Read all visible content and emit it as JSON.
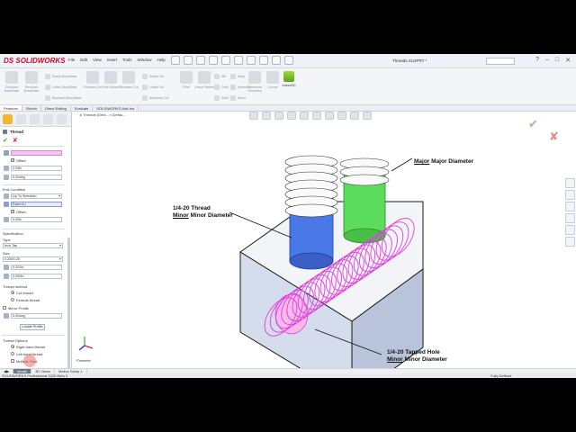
{
  "app": {
    "logo_ds": "DS",
    "logo_text": "SOLIDWORKS",
    "document_title": "Threads.SLDPRT *",
    "status_left": "SOLIDWORKS Professional 2020 Beta 3",
    "status_right": "Fully Defined"
  },
  "menus": [
    "File",
    "Edit",
    "View",
    "Insert",
    "Tools",
    "Window",
    "Help"
  ],
  "ribbon": {
    "big_buttons": [
      "Extruded Boss/Base",
      "Revolved Boss/Base",
      "Swept Boss/Base",
      "Extruded Cut",
      "Hole Wizard",
      "Revolved Cut",
      "Fillet",
      "Linear Pattern",
      "Rib",
      "Wrap",
      "Intersect",
      "Reference Geometry",
      "Curves"
    ],
    "small_buttons": [
      "Swept Boss/Base",
      "Lofted Boss/Base",
      "Boundary Boss/Base",
      "Swept Cut",
      "Lofted Cut",
      "Boundary Cut",
      "Draft",
      "Shell",
      "Mirror"
    ],
    "instant3d": "Instant3D"
  },
  "command_tabs": [
    "Features",
    "Sketch",
    "Direct Editing",
    "Evaluate",
    "SOLIDWORKS Add-Ins"
  ],
  "tree_path": "Threads (Defa...<<Defau...",
  "panel": {
    "title": "Thread",
    "edge_value": "",
    "offset_label": "Offset",
    "offset_value": "0.00in",
    "angle_value": "0.00deg",
    "end_condition_label": "End Condition",
    "end_condition_value": "Up To Selection",
    "face_value": "Face<1>",
    "offset2_label": "Offset",
    "offset2_value": "0.00in",
    "specification_label": "Specification",
    "type_label": "Type",
    "type_value": "Inch Tap",
    "size_label": "Size",
    "size_value": "0.2500-20",
    "diameter_value": "0.201in",
    "pitch_value": "0.050in",
    "thread_method_label": "Thread method",
    "cut_thread": "Cut thread",
    "extrude_thread": "Extrude thread",
    "mirror_profile": "Mirror Profile",
    "rotation_value": "0.00deg",
    "locate_profile": "Locate Profile",
    "thread_options_label": "Thread Options",
    "right_hand": "Right-hand thread",
    "left_hand": "Left-hand thread",
    "multiple_start": "Multiple Start"
  },
  "callouts": {
    "major": [
      "Major Diameter"
    ],
    "thread_minor": [
      "1/4-20 Thread",
      "Minor Diameter"
    ],
    "hole_minor": [
      "1/4-20 Tapped Hole",
      "Minor Diameter"
    ],
    "major_underline_word": "Major",
    "thread_minor_underline_word": "Minor",
    "hole_minor_underline_word": "Minor"
  },
  "view_label": "*Trimetric",
  "bottom_tabs": [
    "Model",
    "3D Views",
    "Motion Study 1"
  ],
  "colors": {
    "thread_pink": "#e040e0",
    "stud_blue": "#4a78e6",
    "stud_green": "#5cdc5c",
    "block_face": "#c8d2e6",
    "accent_orange": "#f2b632"
  }
}
